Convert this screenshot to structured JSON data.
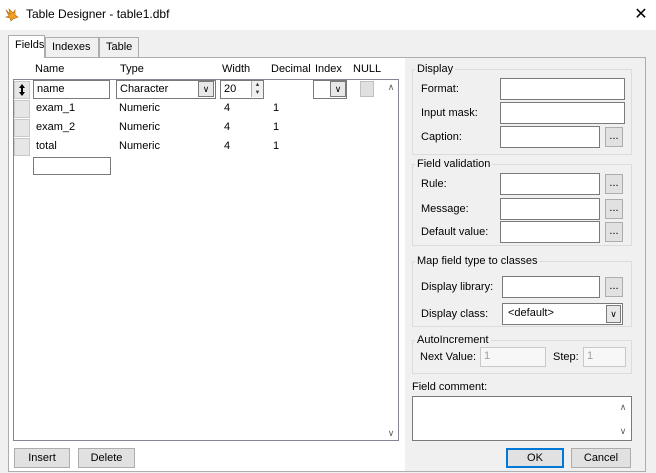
{
  "window": {
    "title": "Table Designer - table1.dbf",
    "close_glyph": "✕"
  },
  "tabs": [
    {
      "label": "Fields",
      "active": true
    },
    {
      "label": "Indexes",
      "active": false
    },
    {
      "label": "Table",
      "active": false
    }
  ],
  "grid": {
    "columns": [
      "Name",
      "Type",
      "Width",
      "Decimal",
      "Index",
      "NULL"
    ],
    "rows": [
      {
        "name": "name",
        "type": "Character",
        "width": "20",
        "decimal": "",
        "editing": true
      },
      {
        "name": "exam_1",
        "type": "Numeric",
        "width": "4",
        "decimal": "1"
      },
      {
        "name": "exam_2",
        "type": "Numeric",
        "width": "4",
        "decimal": "1"
      },
      {
        "name": "total",
        "type": "Numeric",
        "width": "4",
        "decimal": "1"
      }
    ],
    "new_row_value": ""
  },
  "display": {
    "title": "Display",
    "format_label": "Format:",
    "input_mask_label": "Input mask:",
    "caption_label": "Caption:",
    "format_value": "",
    "input_mask_value": "",
    "caption_value": ""
  },
  "validation": {
    "title": "Field validation",
    "rule_label": "Rule:",
    "message_label": "Message:",
    "default_label": "Default value:"
  },
  "map": {
    "title": "Map field type to classes",
    "library_label": "Display library:",
    "class_label": "Display class:",
    "class_value": "<default>"
  },
  "autoinc": {
    "title": "AutoIncrement",
    "next_label": "Next Value:",
    "next_value": "1",
    "step_label": "Step:",
    "step_value": "1"
  },
  "comment": {
    "label": "Field comment:",
    "value": ""
  },
  "buttons": {
    "insert": "Insert",
    "delete": "Delete",
    "ok": "OK",
    "cancel": "Cancel",
    "ellipsis": "..."
  },
  "icons": {
    "app": "fox-logo-icon",
    "row_move": "row-move-icon"
  },
  "colors": {
    "accent": "#0078d7",
    "window_bg": "#f0f0f0"
  }
}
